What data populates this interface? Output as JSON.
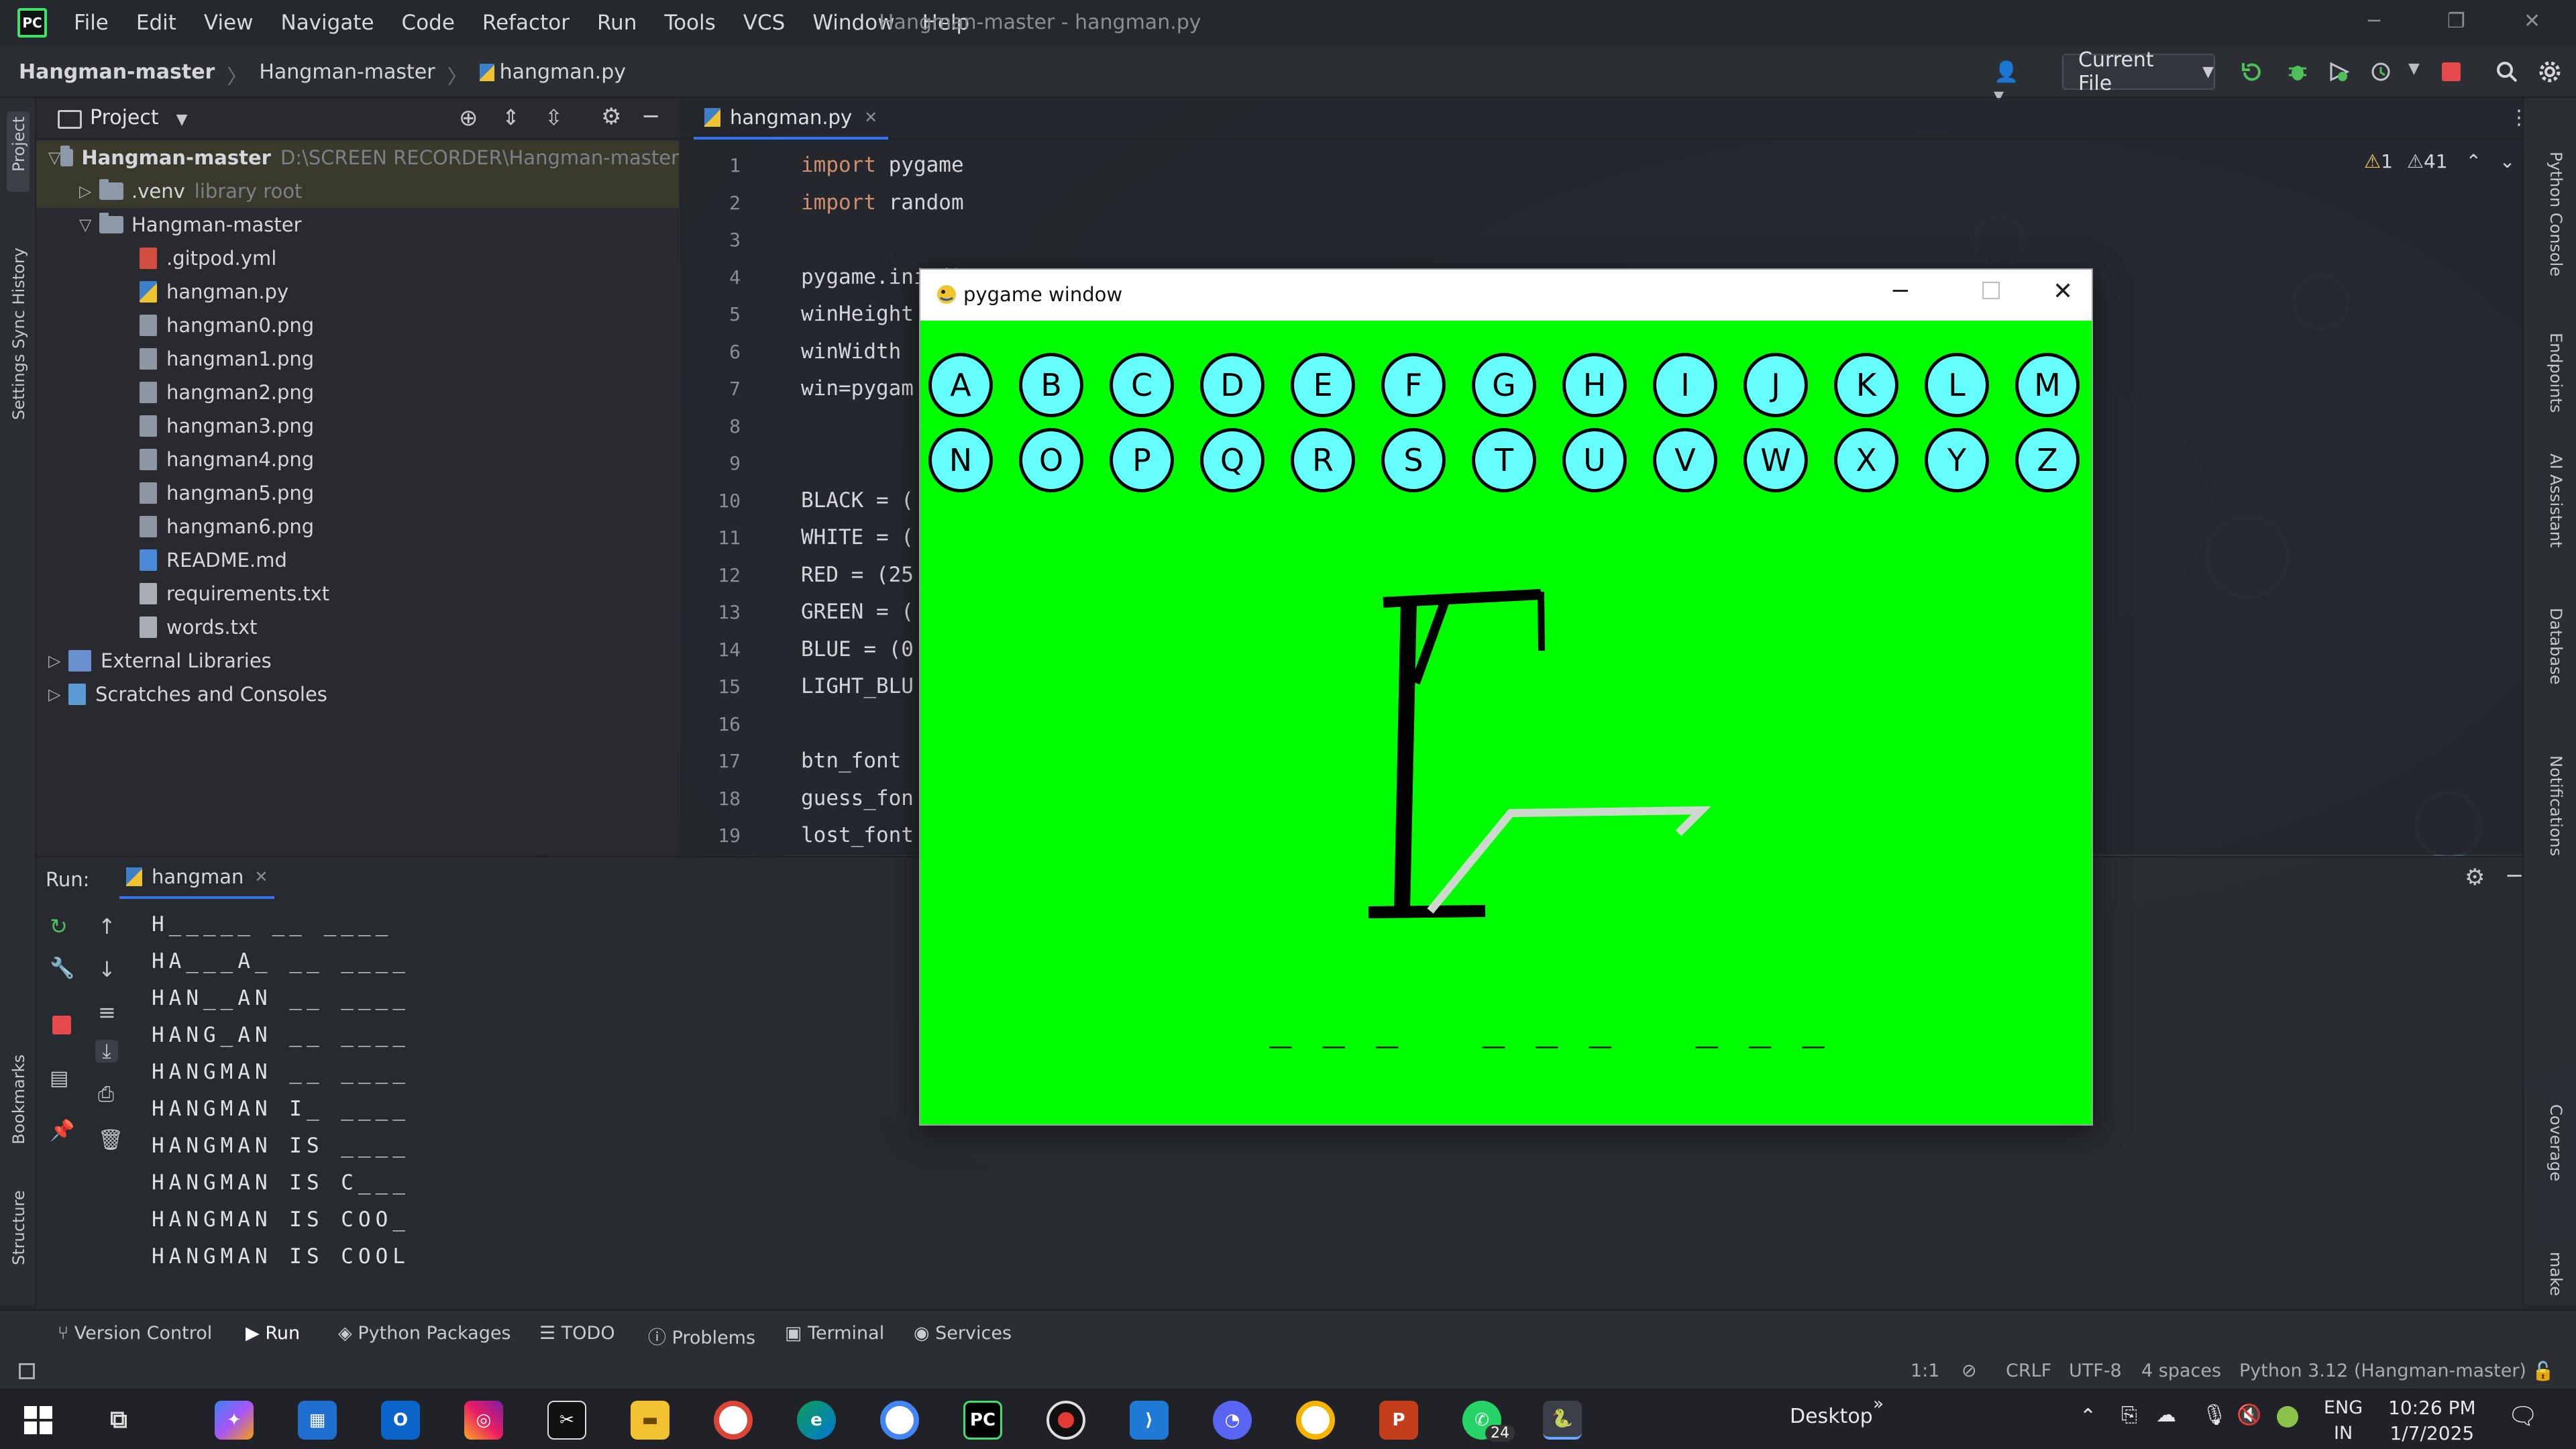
{
  "app": {
    "menu": [
      "File",
      "Edit",
      "View",
      "Navigate",
      "Code",
      "Refactor",
      "Run",
      "Tools",
      "VCS",
      "Window",
      "Help"
    ],
    "window_title": "Hangman-master - hangman.py"
  },
  "navbar": {
    "crumb_project": "Hangman-master",
    "crumb_folder": "Hangman-master",
    "crumb_file": "hangman.py",
    "run_config": "Current File"
  },
  "project_panel": {
    "title": "Project",
    "root_name": "Hangman-master",
    "root_path": "D:\\SCREEN RECORDER\\Hangman-master",
    "venv_name": ".venv",
    "venv_hint": "library root",
    "sub_folder": "Hangman-master",
    "files": [
      {
        "name": ".gitpod.yml",
        "type": "yml"
      },
      {
        "name": "hangman.py",
        "type": "py"
      },
      {
        "name": "hangman0.png",
        "type": "png"
      },
      {
        "name": "hangman1.png",
        "type": "png"
      },
      {
        "name": "hangman2.png",
        "type": "png"
      },
      {
        "name": "hangman3.png",
        "type": "png"
      },
      {
        "name": "hangman4.png",
        "type": "png"
      },
      {
        "name": "hangman5.png",
        "type": "png"
      },
      {
        "name": "hangman6.png",
        "type": "png"
      },
      {
        "name": "README.md",
        "type": "md"
      },
      {
        "name": "requirements.txt",
        "type": "txt"
      },
      {
        "name": "words.txt",
        "type": "txt"
      }
    ],
    "external_libraries": "External Libraries",
    "scratches": "Scratches and Consoles"
  },
  "editor": {
    "tab": "hangman.py",
    "warnings": "1",
    "weak_warnings": "41",
    "lines": [
      {
        "n": "1",
        "kw": "import",
        "rest": " pygame"
      },
      {
        "n": "2",
        "kw": "import",
        "rest": " random"
      },
      {
        "n": "3",
        "kw": "",
        "rest": ""
      },
      {
        "n": "4",
        "kw": "",
        "rest": "pygame.init()"
      },
      {
        "n": "5",
        "kw": "",
        "rest": "winHeight"
      },
      {
        "n": "6",
        "kw": "",
        "rest": "winWidth"
      },
      {
        "n": "7",
        "kw": "",
        "rest": "win=pygam"
      },
      {
        "n": "8",
        "kw": "",
        "rest": ""
      },
      {
        "n": "9",
        "kw": "",
        "rest": ""
      },
      {
        "n": "10",
        "kw": "",
        "rest": "BLACK = ("
      },
      {
        "n": "11",
        "kw": "",
        "rest": "WHITE = ("
      },
      {
        "n": "12",
        "kw": "",
        "rest": "RED = (25"
      },
      {
        "n": "13",
        "kw": "",
        "rest": "GREEN = ("
      },
      {
        "n": "14",
        "kw": "",
        "rest": "BLUE = (0"
      },
      {
        "n": "15",
        "kw": "",
        "rest": "LIGHT_BLU"
      },
      {
        "n": "16",
        "kw": "",
        "rest": ""
      },
      {
        "n": "17",
        "kw": "",
        "rest": "btn_font"
      },
      {
        "n": "18",
        "kw": "",
        "rest": "guess_fon"
      },
      {
        "n": "19",
        "kw": "",
        "rest": "lost_font"
      }
    ]
  },
  "run_panel": {
    "label": "Run:",
    "tab": "hangman",
    "output": [
      "H_____ __ ____",
      "HA___A_ __ ____",
      "HAN__AN __ ____",
      "HANG_AN __ ____",
      "HANGMAN __ ____",
      "HANGMAN I_ ____",
      "HANGMAN IS ____",
      "HANGMAN IS C___",
      "HANGMAN IS COO_",
      "HANGMAN IS COOL"
    ]
  },
  "left_strip": {
    "project": "Project",
    "sync": "Settings Sync History",
    "bookmarks": "Bookmarks",
    "structure": "Structure"
  },
  "right_strip": {
    "python_console": "Python Console",
    "endpoints": "Endpoints",
    "ai": "AI Assistant",
    "database": "Database",
    "notifications": "Notifications",
    "coverage": "Coverage",
    "make": "make"
  },
  "bottom_tools": [
    "Version Control",
    "Run",
    "Python Packages",
    "TODO",
    "Problems",
    "Terminal",
    "Services"
  ],
  "status": {
    "position": "1:1",
    "line_sep": "CRLF",
    "encoding": "UTF-8",
    "indent": "4 spaces",
    "interpreter": "Python 3.12 (Hangman-master)"
  },
  "pygame": {
    "title": "pygame window",
    "letters_row1": [
      "A",
      "B",
      "C",
      "D",
      "E",
      "F",
      "G",
      "H",
      "I",
      "J",
      "K",
      "L",
      "M"
    ],
    "letters_row2": [
      "N",
      "O",
      "P",
      "Q",
      "R",
      "S",
      "T",
      "U",
      "V",
      "W",
      "X",
      "Y",
      "Z"
    ],
    "guess_display": "_ _ _   _ _ _   _ _ _",
    "bg_color": "#00ff00",
    "button_color": "#66ffff"
  },
  "taskbar": {
    "desktop_label": "Desktop",
    "whatsapp_badge": "24",
    "lang_top": "ENG",
    "lang_bottom": "IN",
    "time": "10:26 PM",
    "date": "1/7/2025"
  }
}
